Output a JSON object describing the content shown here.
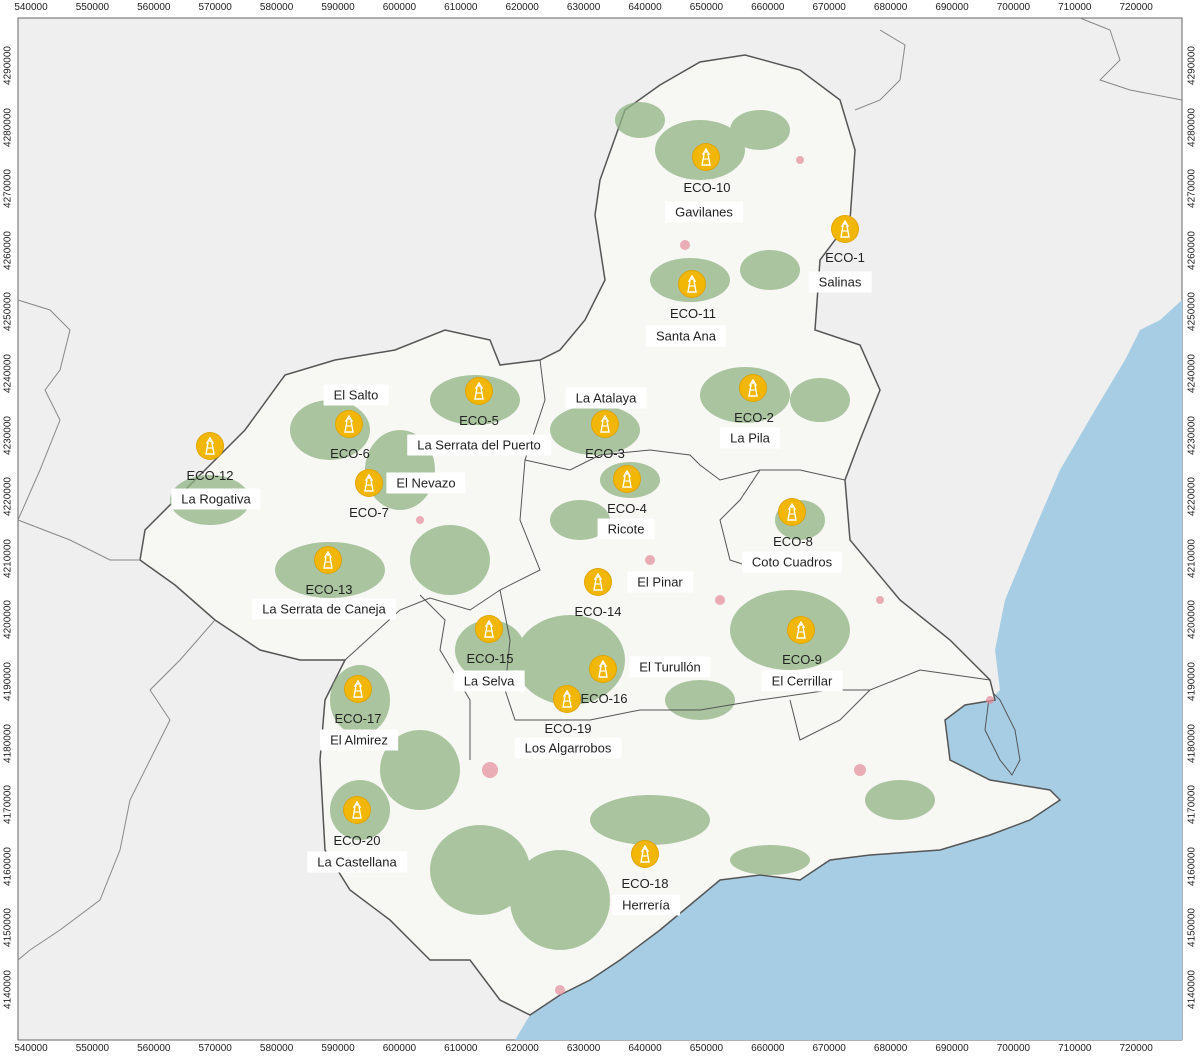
{
  "map": {
    "x_ticks": [
      "540000",
      "550000",
      "560000",
      "570000",
      "580000",
      "590000",
      "600000",
      "610000",
      "620000",
      "630000",
      "640000",
      "650000",
      "660000",
      "670000",
      "680000",
      "690000",
      "700000",
      "710000",
      "720000"
    ],
    "y_ticks": [
      "4290000",
      "4280000",
      "4270000",
      "4260000",
      "4250000",
      "4240000",
      "4230000",
      "4220000",
      "4210000",
      "4200000",
      "4190000",
      "4180000",
      "4170000",
      "4160000",
      "4150000",
      "4140000"
    ],
    "colors": {
      "sea": "#a6cde3",
      "land_outside": "#efefef",
      "region": "#f7f7f4",
      "forest": "#8fb383",
      "border": "#555555",
      "marker": "#f2b705"
    },
    "marker_icon": "tower-icon",
    "stations": [
      {
        "code": "ECO-10",
        "name": "Gavilanes"
      },
      {
        "code": "ECO-1",
        "name": "Salinas"
      },
      {
        "code": "ECO-11",
        "name": "Santa Ana"
      },
      {
        "code": "ECO-5",
        "name": "La Serrata del Puerto"
      },
      {
        "code": "ECO-2",
        "name": "La Pila"
      },
      {
        "code": "ECO-3",
        "name": "La Atalaya"
      },
      {
        "code": "ECO-6",
        "name": "El Salto"
      },
      {
        "code": "ECO-7",
        "name": "El Nevazo"
      },
      {
        "code": "ECO-12",
        "name": "La Rogativa"
      },
      {
        "code": "ECO-4",
        "name": "Ricote"
      },
      {
        "code": "ECO-8",
        "name": "Coto Cuadros"
      },
      {
        "code": "ECO-13",
        "name": "La Serrata de Caneja"
      },
      {
        "code": "ECO-14",
        "name": "El Pinar"
      },
      {
        "code": "ECO-15",
        "name": "La Selva"
      },
      {
        "code": "ECO-9",
        "name": "El Cerrillar"
      },
      {
        "code": "ECO-16",
        "name": "El Turullón"
      },
      {
        "code": "ECO-19",
        "name": "Los Algarrobos"
      },
      {
        "code": "ECO-17",
        "name": "El Almirez"
      },
      {
        "code": "ECO-20",
        "name": "La Castellana"
      },
      {
        "code": "ECO-18",
        "name": "Herrería"
      }
    ]
  }
}
